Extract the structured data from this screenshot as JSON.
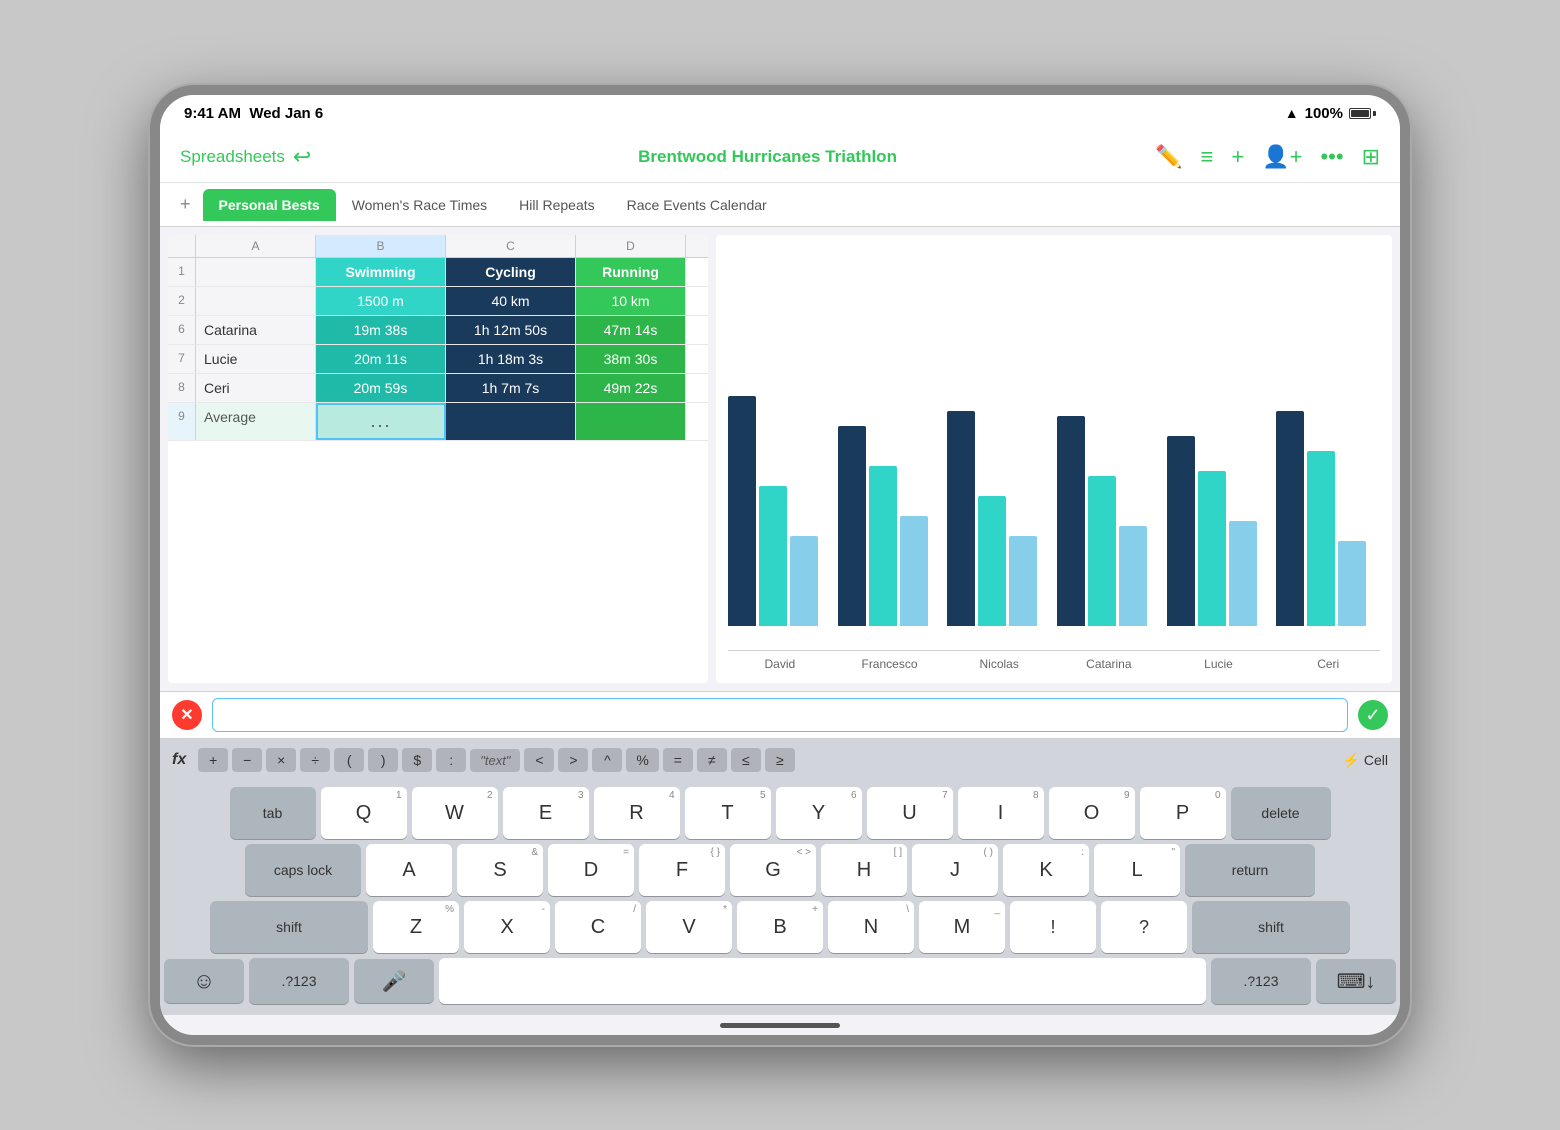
{
  "status_bar": {
    "time": "9:41 AM",
    "date": "Wed Jan 6",
    "wifi": "WiFi",
    "battery": "100%"
  },
  "header": {
    "back_label": "Spreadsheets",
    "title": "Brentwood Hurricanes Triathlon",
    "undo_icon": "↩",
    "icons": [
      "pencil-ruler",
      "lines",
      "plus",
      "person-plus",
      "ellipsis",
      "table"
    ]
  },
  "tabs": [
    {
      "label": "Personal Bests",
      "active": true
    },
    {
      "label": "Women's Race Times",
      "active": false
    },
    {
      "label": "Hill Repeats",
      "active": false
    },
    {
      "label": "Race Events Calendar",
      "active": false
    }
  ],
  "spreadsheet": {
    "columns": [
      "",
      "A",
      "B",
      "C",
      "D"
    ],
    "rows": [
      {
        "num": "1",
        "cells": [
          "",
          "Swimming",
          "Cycling",
          "Running"
        ]
      },
      {
        "num": "2",
        "cells": [
          "",
          "1500 m",
          "40 km",
          "10 km"
        ]
      },
      {
        "num": "6",
        "cells": [
          "Catarina",
          "19m 38s",
          "1h 12m 50s",
          "47m 14s"
        ]
      },
      {
        "num": "7",
        "cells": [
          "Lucie",
          "20m 11s",
          "1h 18m 3s",
          "38m 30s"
        ]
      },
      {
        "num": "8",
        "cells": [
          "Ceri",
          "20m 59s",
          "1h 7m 7s",
          "49m 22s"
        ]
      },
      {
        "num": "9",
        "cells": [
          "Average",
          "...",
          "",
          ""
        ]
      }
    ]
  },
  "chart": {
    "groups": [
      {
        "label": "David",
        "bars": [
          230,
          140,
          90
        ]
      },
      {
        "label": "Francesco",
        "bars": [
          200,
          165,
          110
        ]
      },
      {
        "label": "Nicolas",
        "bars": [
          220,
          130,
          95
        ]
      },
      {
        "label": "Catarina",
        "bars": [
          210,
          150,
          100
        ]
      },
      {
        "label": "Lucie",
        "bars": [
          190,
          155,
          105
        ]
      },
      {
        "label": "Ceri",
        "bars": [
          215,
          175,
          85
        ]
      }
    ]
  },
  "formula_bar": {
    "cancel_icon": "✕",
    "confirm_icon": "✓",
    "input_value": ""
  },
  "formula_toolbar": {
    "fx_label": "fx",
    "buttons": [
      "+",
      "−",
      "×",
      "÷",
      "(",
      ")",
      "$",
      ":",
      "\"text\"",
      "<",
      ">",
      "^",
      "%",
      "=",
      "≠",
      "≤",
      "≥"
    ],
    "cell_ref": "⚡ Cell"
  },
  "keyboard": {
    "row1": [
      {
        "label": "Q",
        "sub": "1"
      },
      {
        "label": "W",
        "sub": "2"
      },
      {
        "label": "E",
        "sub": "3"
      },
      {
        "label": "R",
        "sub": "4"
      },
      {
        "label": "T",
        "sub": "5"
      },
      {
        "label": "Y",
        "sub": "6"
      },
      {
        "label": "U",
        "sub": "7"
      },
      {
        "label": "I",
        "sub": "8"
      },
      {
        "label": "O",
        "sub": "9"
      },
      {
        "label": "P",
        "sub": "0"
      }
    ],
    "row2": [
      {
        "label": "A",
        "sub": ""
      },
      {
        "label": "S",
        "sub": "&"
      },
      {
        "label": "D",
        "sub": "="
      },
      {
        "label": "F",
        "sub": "{  }"
      },
      {
        "label": "G",
        "sub": "<  >"
      },
      {
        "label": "H",
        "sub": "[  ]"
      },
      {
        "label": "J",
        "sub": "(  )"
      },
      {
        "label": "K",
        "sub": ":"
      },
      {
        "label": "L",
        "sub": "\""
      }
    ],
    "row3": [
      {
        "label": "Z",
        "sub": "%"
      },
      {
        "label": "X",
        "sub": "-"
      },
      {
        "label": "C",
        "sub": "/"
      },
      {
        "label": "V",
        "sub": "*"
      },
      {
        "label": "B",
        "sub": "+"
      },
      {
        "label": "N",
        "sub": "\\"
      },
      {
        "label": "M",
        "sub": "_"
      },
      {
        "label": "!",
        "sub": ""
      },
      {
        "label": "?",
        "sub": ""
      }
    ],
    "tab_label": "tab",
    "caps_label": "caps lock",
    "shift_label": "shift",
    "delete_label": "delete",
    "return_label": "return",
    "emoji_icon": "☺",
    "punct_label": ".?123",
    "mic_icon": "🎤",
    "hide_icon": "⌨"
  }
}
